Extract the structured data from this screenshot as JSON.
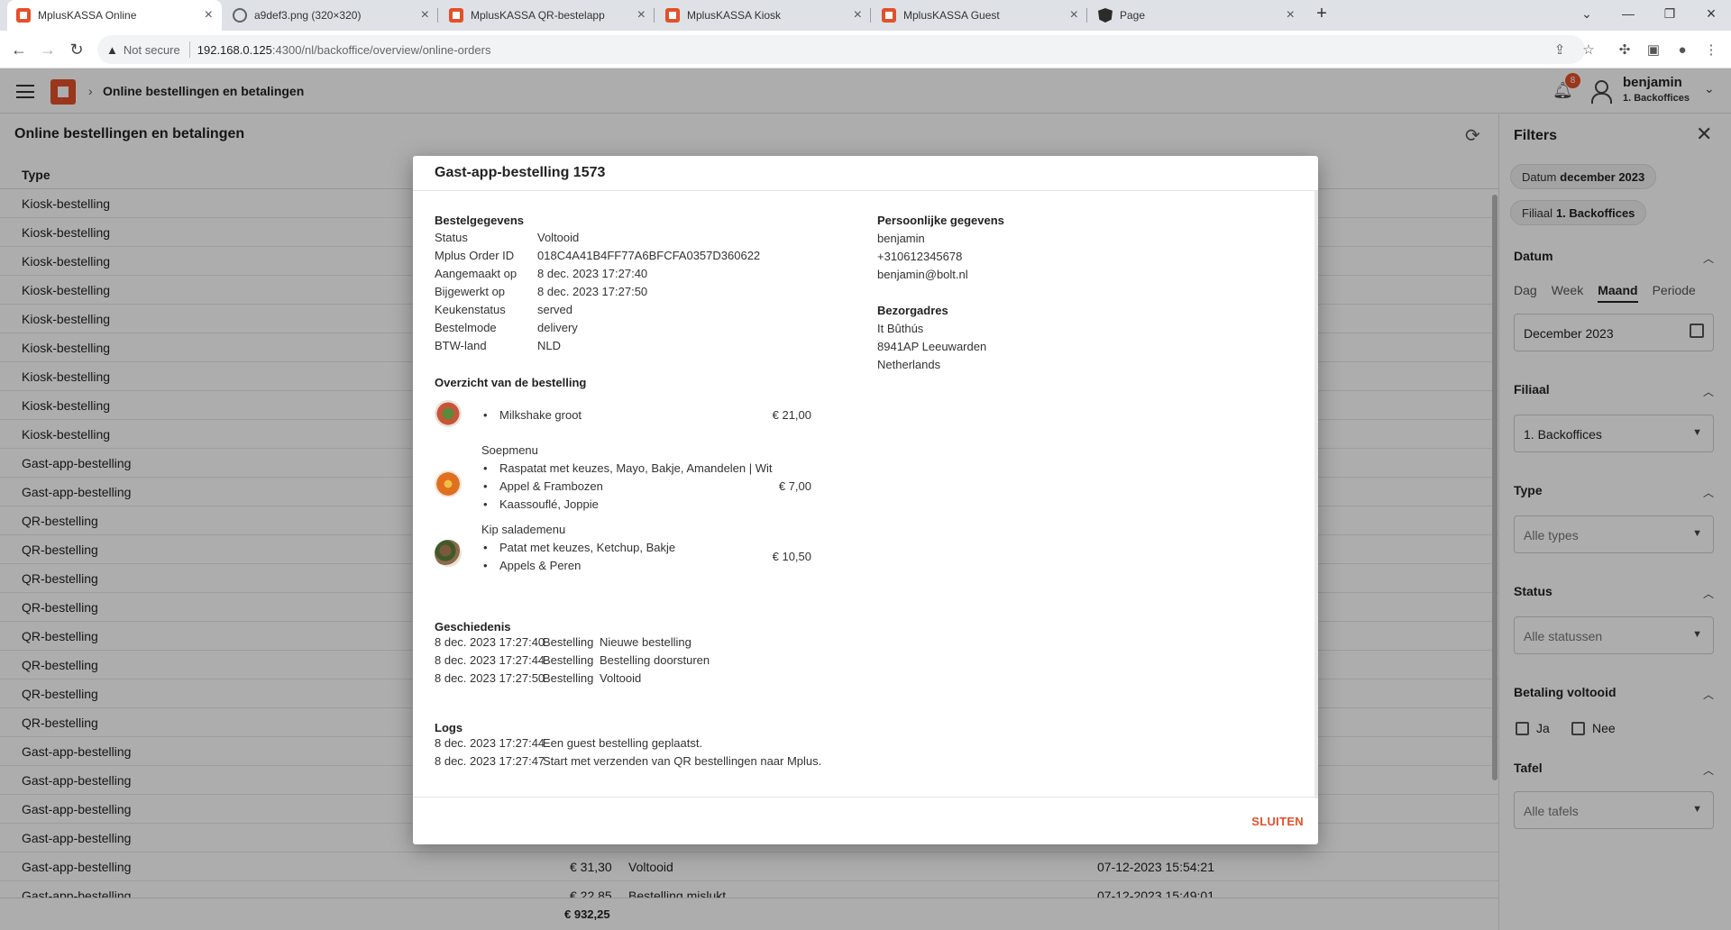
{
  "browser": {
    "tabs": [
      {
        "title": "MplusKASSA Online",
        "icon": "mplus-favicon",
        "active": true
      },
      {
        "title": "a9def3.png (320×320)",
        "icon": "globe-icon",
        "active": false
      },
      {
        "title": "MplusKASSA QR-bestelapp",
        "icon": "mplus-favicon",
        "active": false
      },
      {
        "title": "MplusKASSA Kiosk",
        "icon": "mplus-favicon",
        "active": false
      },
      {
        "title": "MplusKASSA Guest",
        "icon": "mplus-favicon",
        "active": false
      },
      {
        "title": "Page",
        "icon": "angular-icon",
        "active": false
      }
    ],
    "security": "Not secure",
    "url_host": "192.168.0.125",
    "url_path": ":4300/nl/backoffice/overview/online-orders"
  },
  "header": {
    "breadcrumb": "Online bestellingen en betalingen",
    "notifications": "8",
    "user_name": "benjamin",
    "user_branch": "1. Backoffices"
  },
  "main": {
    "title": "Online bestellingen en betalingen",
    "type_header": "Type",
    "rows": [
      {
        "type": "Kiosk-bestelling",
        "amount": "",
        "status": "",
        "date": ""
      },
      {
        "type": "Kiosk-bestelling",
        "amount": "",
        "status": "",
        "date": ""
      },
      {
        "type": "Kiosk-bestelling",
        "amount": "",
        "status": "",
        "date": ""
      },
      {
        "type": "Kiosk-bestelling",
        "amount": "",
        "status": "",
        "date": ""
      },
      {
        "type": "Kiosk-bestelling",
        "amount": "",
        "status": "",
        "date": ""
      },
      {
        "type": "Kiosk-bestelling",
        "amount": "",
        "status": "",
        "date": ""
      },
      {
        "type": "Kiosk-bestelling",
        "amount": "",
        "status": "",
        "date": ""
      },
      {
        "type": "Kiosk-bestelling",
        "amount": "",
        "status": "",
        "date": ""
      },
      {
        "type": "Kiosk-bestelling",
        "amount": "",
        "status": "",
        "date": ""
      },
      {
        "type": "Gast-app-bestelling",
        "amount": "",
        "status": "",
        "date": ""
      },
      {
        "type": "Gast-app-bestelling",
        "amount": "",
        "status": "",
        "date": ""
      },
      {
        "type": "QR-bestelling",
        "amount": "",
        "status": "",
        "date": ""
      },
      {
        "type": "QR-bestelling",
        "amount": "",
        "status": "",
        "date": ""
      },
      {
        "type": "QR-bestelling",
        "amount": "",
        "status": "",
        "date": ""
      },
      {
        "type": "QR-bestelling",
        "amount": "",
        "status": "",
        "date": ""
      },
      {
        "type": "QR-bestelling",
        "amount": "",
        "status": "",
        "date": ""
      },
      {
        "type": "QR-bestelling",
        "amount": "",
        "status": "",
        "date": ""
      },
      {
        "type": "QR-bestelling",
        "amount": "",
        "status": "",
        "date": ""
      },
      {
        "type": "QR-bestelling",
        "amount": "",
        "status": "",
        "date": ""
      },
      {
        "type": "Gast-app-bestelling",
        "amount": "",
        "status": "",
        "date": ""
      },
      {
        "type": "Gast-app-bestelling",
        "amount": "",
        "status": "",
        "date": ""
      },
      {
        "type": "Gast-app-bestelling",
        "amount": "",
        "status": "",
        "date": ""
      },
      {
        "type": "Gast-app-bestelling",
        "amount": "",
        "status": "",
        "date": ""
      },
      {
        "type": "Gast-app-bestelling",
        "amount": "€ 31,30",
        "status": "Voltooid",
        "date": "07-12-2023 15:54:21"
      },
      {
        "type": "Gast-app-bestelling",
        "amount": "€ 22,85",
        "status": "Bestelling mislukt",
        "date": "07-12-2023 15:49:01"
      }
    ],
    "total": "€ 932,25"
  },
  "filters": {
    "title": "Filters",
    "chip_date_label": "Datum",
    "chip_date_value": "december 2023",
    "chip_branch_label": "Filiaal",
    "chip_branch_value": "1. Backoffices",
    "datum_title": "Datum",
    "periods": [
      "Dag",
      "Week",
      "Maand",
      "Periode"
    ],
    "selected_period": "Maand",
    "date_value": "December 2023",
    "filiaal_title": "Filiaal",
    "filiaal_value": "1. Backoffices",
    "type_title": "Type",
    "type_placeholder": "Alle types",
    "status_title": "Status",
    "status_placeholder": "Alle statussen",
    "payment_title": "Betaling voltooid",
    "payment_yes": "Ja",
    "payment_no": "Nee",
    "tafel_title": "Tafel",
    "tafel_placeholder": "Alle tafels"
  },
  "modal": {
    "title": "Gast-app-bestelling 1573",
    "order_details_title": "Bestelgegevens",
    "order_details": [
      {
        "key": "Status",
        "value": "Voltooid"
      },
      {
        "key": "Mplus Order ID",
        "value": "018C4A41B4FF77A6BFCFA0357D360622"
      },
      {
        "key": "Aangemaakt op",
        "value": "8 dec. 2023 17:27:40"
      },
      {
        "key": "Bijgewerkt op",
        "value": "8 dec. 2023 17:27:50"
      },
      {
        "key": "Keukenstatus",
        "value": "served"
      },
      {
        "key": "Bestelmode",
        "value": "delivery"
      },
      {
        "key": "BTW-land",
        "value": "NLD"
      }
    ],
    "personal_title": "Persoonlijke gegevens",
    "personal": [
      "benjamin",
      "+310612345678",
      "benjamin@bolt.nl"
    ],
    "address_title": "Bezorgadres",
    "address": [
      "It Bûthús",
      "8941AP Leeuwarden",
      "Netherlands"
    ],
    "overview_title": "Overzicht van de bestelling",
    "items": [
      {
        "name": "",
        "lines": [
          "Milkshake groot"
        ],
        "price": "€ 21,00"
      },
      {
        "name": "Soepmenu",
        "lines": [
          "Raspatat met keuzes, Mayo, Bakje, Amandelen | Wit",
          "Appel & Frambozen",
          "Kaassouflé, Joppie"
        ],
        "price": "€ 7,00"
      },
      {
        "name": "Kip salademenu",
        "lines": [
          "Patat met keuzes, Ketchup, Bakje",
          "Appels & Peren"
        ],
        "price": "€ 10,50"
      }
    ],
    "history_title": "Geschiedenis",
    "history": [
      {
        "time": "8 dec. 2023 17:27:40",
        "kind": "Bestelling",
        "text": "Nieuwe bestelling"
      },
      {
        "time": "8 dec. 2023 17:27:44",
        "kind": "Bestelling",
        "text": "Bestelling doorsturen"
      },
      {
        "time": "8 dec. 2023 17:27:50",
        "kind": "Bestelling",
        "text": "Voltooid"
      }
    ],
    "logs_title": "Logs",
    "logs": [
      {
        "time": "8 dec. 2023 17:27:44",
        "text": "Een guest bestelling geplaatst."
      },
      {
        "time": "8 dec. 2023 17:27:47",
        "text": "Start met verzenden van QR bestellingen naar Mplus."
      }
    ],
    "close_label": "SLUITEN"
  },
  "colors": {
    "brand": "#e4502a",
    "overlay": "rgba(0,0,0,0.32)"
  }
}
